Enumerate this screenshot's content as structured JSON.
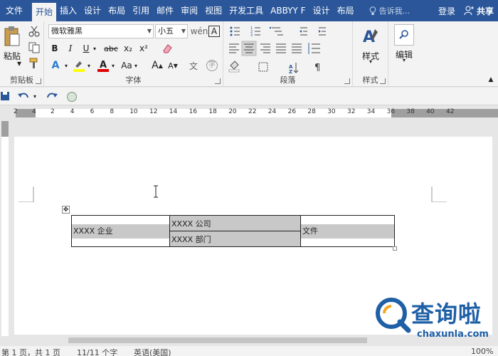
{
  "tabs": [
    "文件",
    "开始",
    "插入",
    "设计",
    "布局",
    "引用",
    "邮件",
    "审阅",
    "视图",
    "开发工具",
    "ABBYY F",
    "设计",
    "布局"
  ],
  "active_tab_index": 1,
  "tell_me": "告诉我...",
  "sign_in": "登录",
  "share": "共享",
  "clipboard": {
    "paste_label": "粘贴",
    "group_label": "剪贴板"
  },
  "font": {
    "name": "微软雅黑",
    "size": "小五",
    "bold": "B",
    "italic": "I",
    "underline": "U",
    "strike": "abc",
    "subscript": "x₂",
    "superscript": "x²",
    "grow": "A",
    "shrink": "A",
    "case": "Aa",
    "group_label": "字体"
  },
  "paragraph": {
    "group_label": "段落"
  },
  "styles": {
    "label": "样式",
    "group_label": "样式"
  },
  "editing": {
    "label": "编辑"
  },
  "ruler_ticks": [
    "4",
    "2",
    "2",
    "4",
    "6",
    "8",
    "10",
    "12",
    "14",
    "16",
    "18",
    "20",
    "22",
    "24",
    "26",
    "28",
    "30",
    "32",
    "34",
    "36",
    "38",
    "40",
    "42"
  ],
  "table": {
    "cell_company": "XXXX 企业",
    "cell_sub1": "XXXX 公司",
    "cell_sub2": "XXXX 部门",
    "cell_doc": "文件"
  },
  "status": {
    "page": "第 1 页，共 1 页",
    "words": "11/11 个字",
    "lang": "英语(美国)",
    "zoom": "100%"
  },
  "watermark": {
    "brand": "查询啦",
    "site": "chaxunla.com"
  },
  "colors": {
    "accent": "#2b579a",
    "highlight": "#ffff00",
    "font_red": "#e00000",
    "selection": "#c8c8c8"
  }
}
